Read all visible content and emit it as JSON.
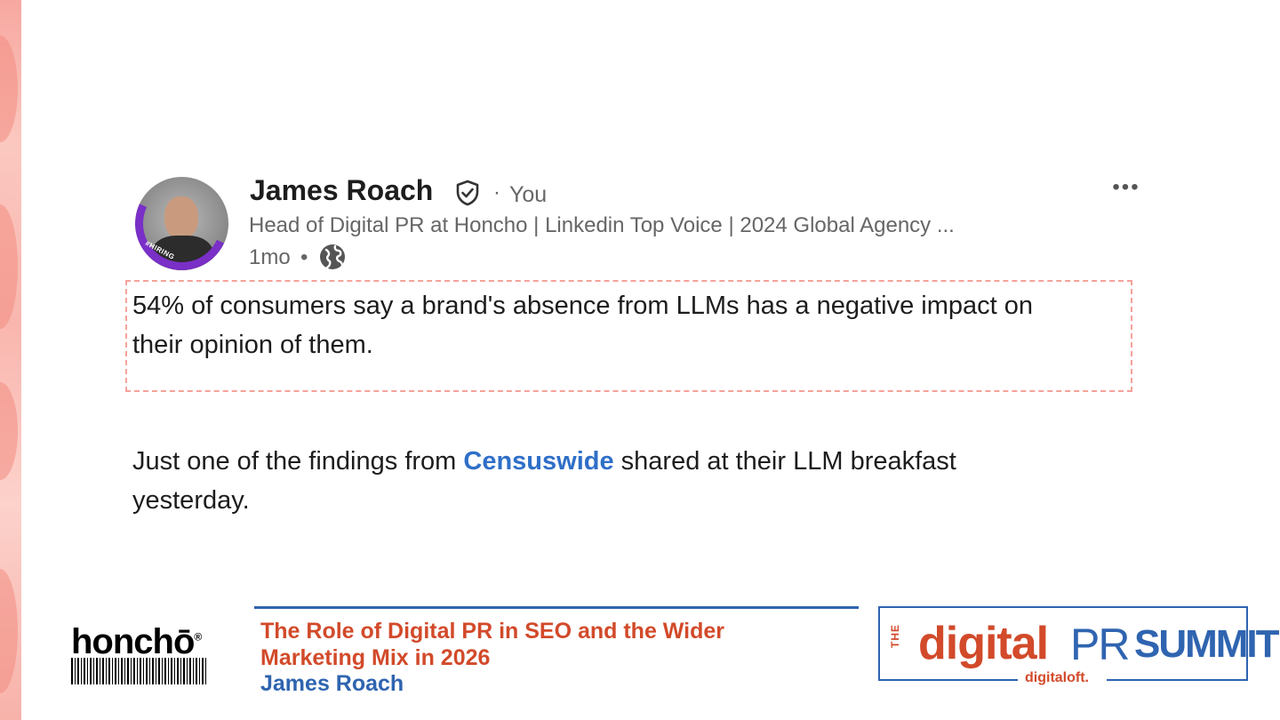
{
  "post": {
    "author_name": "James Roach",
    "relationship": "You",
    "headline": "Head of Digital PR at Honcho | Linkedin Top Voice | 2024 Global Agency ...",
    "age": "1mo",
    "avatar_badge": "#HIRING",
    "icons": [
      "verified-icon",
      "globe-icon",
      "more-icon"
    ],
    "body_line_1": "54% of consumers say a brand's absence from LLMs has a negative impact on",
    "body_line_2": "their opinion of them.",
    "body_line_3_before": "Just one of the findings from ",
    "body_line_3_link": "Censuswide",
    "body_line_3_after": " shared at their LLM breakfast",
    "body_line_4": "yesterday."
  },
  "footer": {
    "honcho_logo": "honchō",
    "honcho_reg": "®",
    "talk_title_line_1": "The Role of Digital PR in SEO and the Wider",
    "talk_title_line_2": "Marketing Mix in 2026",
    "speaker": "James Roach",
    "summit_the": "THE",
    "summit_digital": "digital",
    "summit_pr": "PR",
    "summit_summit": "SUMMIT",
    "summit_sub": "digitaloft."
  },
  "colors": {
    "accent_red": "#d24a2a",
    "accent_blue": "#2f64b0",
    "link_blue": "#2f6fc8",
    "highlight_border": "#f4a39a"
  }
}
